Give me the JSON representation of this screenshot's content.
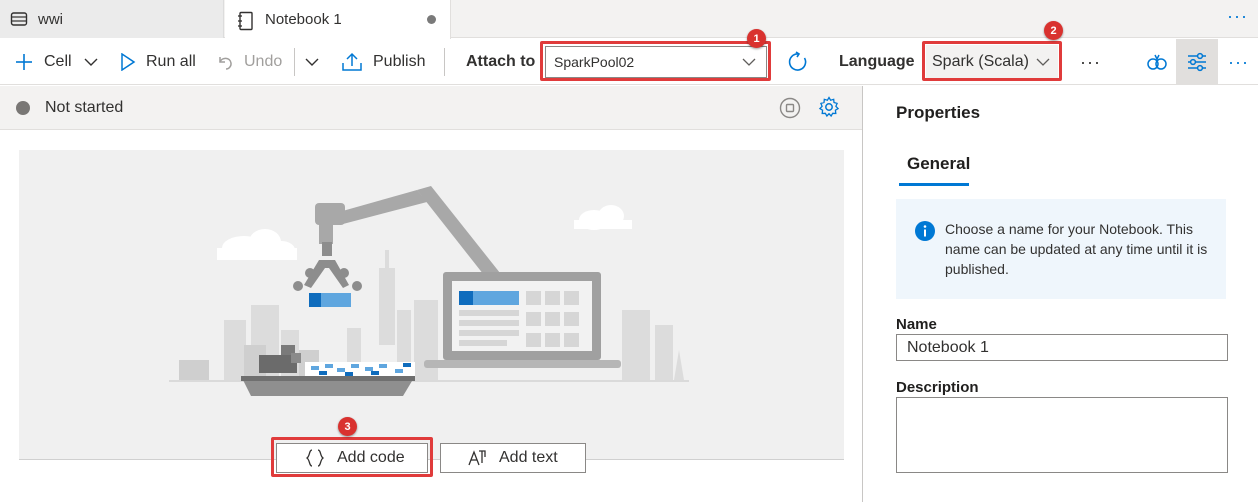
{
  "tabs": [
    {
      "label": "wwi",
      "icon": "database-icon"
    },
    {
      "label": "Notebook 1",
      "icon": "notebook-icon",
      "unsaved": true
    }
  ],
  "tabbar_more": "···",
  "toolbar": {
    "cell_label": "Cell",
    "run_all_label": "Run all",
    "undo_label": "Undo",
    "publish_label": "Publish",
    "attach_label": "Attach to",
    "attach_value": "SparkPool02",
    "language_label": "Language",
    "language_value": "Spark (Scala)",
    "more": "···"
  },
  "status": {
    "text": "Not started"
  },
  "canvas": {
    "add_code_label": "Add code",
    "add_text_label": "Add text"
  },
  "callouts": [
    "1",
    "2",
    "3"
  ],
  "properties": {
    "title": "Properties",
    "tab": "General",
    "info": "Choose a name for your Notebook. This name can be updated at any time until it is published.",
    "name_label": "Name",
    "name_value": "Notebook 1",
    "description_label": "Description",
    "description_value": ""
  },
  "colors": {
    "accent": "#0078d4",
    "callout": "#d9322f",
    "highlight_box": "#e03b3b"
  }
}
